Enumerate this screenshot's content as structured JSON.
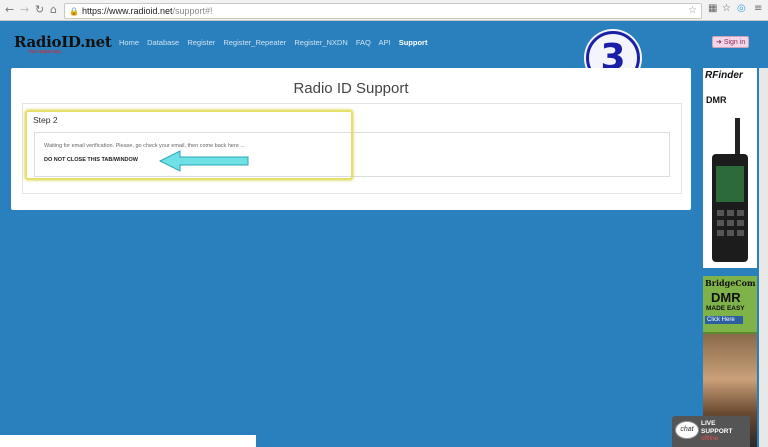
{
  "browser": {
    "back_icon": "back-arrow-icon",
    "url_host": "https://www.radioid.net",
    "url_path": "/support#!"
  },
  "site": {
    "logo_text": "RadioID.net",
    "logo_tag": "Your unique way ...",
    "nav": [
      "Home",
      "Database",
      "Register",
      "Register_Repeater",
      "Register_NXDN",
      "FAQ",
      "API",
      "Support"
    ],
    "active_nav": "Support",
    "sign_in": "Sign in"
  },
  "annotation": {
    "number": "3"
  },
  "panel": {
    "title": "Radio ID Support",
    "step": "Step 2",
    "message": "Waiting for email verification. Please, go check your email, then come back here ...",
    "warning": "DO NOT CLOSE THIS TAB/WINDOW"
  },
  "ads": {
    "rfinder_brand": "RFinder",
    "rfinder_sub": "DMR",
    "bridgecom_brand": "BridgeCom",
    "bridgecom_line1": "DMR",
    "bridgecom_line2": "MADE EASY",
    "bridgecom_cta": "Click Here"
  },
  "chat": {
    "bubble": "chat",
    "line1": "LIVE",
    "line2": "SUPPORT",
    "status": "offline"
  },
  "colors": {
    "page_bg": "#2a80bd",
    "highlight": "#e6e06a",
    "arrow": "#6ee0e6",
    "badge": "#1a20a8"
  }
}
